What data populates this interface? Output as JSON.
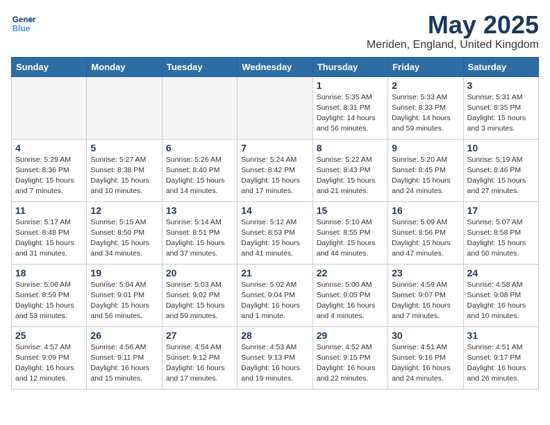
{
  "header": {
    "logo_line1": "General",
    "logo_line2": "Blue",
    "title": "May 2025",
    "subtitle": "Meriden, England, United Kingdom"
  },
  "weekdays": [
    "Sunday",
    "Monday",
    "Tuesday",
    "Wednesday",
    "Thursday",
    "Friday",
    "Saturday"
  ],
  "weeks": [
    [
      {
        "day": "",
        "info": "",
        "empty": true
      },
      {
        "day": "",
        "info": "",
        "empty": true
      },
      {
        "day": "",
        "info": "",
        "empty": true
      },
      {
        "day": "",
        "info": "",
        "empty": true
      },
      {
        "day": "1",
        "info": "Sunrise: 5:35 AM\nSunset: 8:31 PM\nDaylight: 14 hours\nand 56 minutes."
      },
      {
        "day": "2",
        "info": "Sunrise: 5:33 AM\nSunset: 8:33 PM\nDaylight: 14 hours\nand 59 minutes."
      },
      {
        "day": "3",
        "info": "Sunrise: 5:31 AM\nSunset: 8:35 PM\nDaylight: 15 hours\nand 3 minutes."
      }
    ],
    [
      {
        "day": "4",
        "info": "Sunrise: 5:29 AM\nSunset: 8:36 PM\nDaylight: 15 hours\nand 7 minutes."
      },
      {
        "day": "5",
        "info": "Sunrise: 5:27 AM\nSunset: 8:38 PM\nDaylight: 15 hours\nand 10 minutes."
      },
      {
        "day": "6",
        "info": "Sunrise: 5:26 AM\nSunset: 8:40 PM\nDaylight: 15 hours\nand 14 minutes."
      },
      {
        "day": "7",
        "info": "Sunrise: 5:24 AM\nSunset: 8:42 PM\nDaylight: 15 hours\nand 17 minutes."
      },
      {
        "day": "8",
        "info": "Sunrise: 5:22 AM\nSunset: 8:43 PM\nDaylight: 15 hours\nand 21 minutes."
      },
      {
        "day": "9",
        "info": "Sunrise: 5:20 AM\nSunset: 8:45 PM\nDaylight: 15 hours\nand 24 minutes."
      },
      {
        "day": "10",
        "info": "Sunrise: 5:19 AM\nSunset: 8:46 PM\nDaylight: 15 hours\nand 27 minutes."
      }
    ],
    [
      {
        "day": "11",
        "info": "Sunrise: 5:17 AM\nSunset: 8:48 PM\nDaylight: 15 hours\nand 31 minutes."
      },
      {
        "day": "12",
        "info": "Sunrise: 5:15 AM\nSunset: 8:50 PM\nDaylight: 15 hours\nand 34 minutes."
      },
      {
        "day": "13",
        "info": "Sunrise: 5:14 AM\nSunset: 8:51 PM\nDaylight: 15 hours\nand 37 minutes."
      },
      {
        "day": "14",
        "info": "Sunrise: 5:12 AM\nSunset: 8:53 PM\nDaylight: 15 hours\nand 41 minutes."
      },
      {
        "day": "15",
        "info": "Sunrise: 5:10 AM\nSunset: 8:55 PM\nDaylight: 15 hours\nand 44 minutes."
      },
      {
        "day": "16",
        "info": "Sunrise: 5:09 AM\nSunset: 8:56 PM\nDaylight: 15 hours\nand 47 minutes."
      },
      {
        "day": "17",
        "info": "Sunrise: 5:07 AM\nSunset: 8:58 PM\nDaylight: 15 hours\nand 50 minutes."
      }
    ],
    [
      {
        "day": "18",
        "info": "Sunrise: 5:06 AM\nSunset: 8:59 PM\nDaylight: 15 hours\nand 53 minutes."
      },
      {
        "day": "19",
        "info": "Sunrise: 5:04 AM\nSunset: 9:01 PM\nDaylight: 15 hours\nand 56 minutes."
      },
      {
        "day": "20",
        "info": "Sunrise: 5:03 AM\nSunset: 9:02 PM\nDaylight: 15 hours\nand 59 minutes."
      },
      {
        "day": "21",
        "info": "Sunrise: 5:02 AM\nSunset: 9:04 PM\nDaylight: 16 hours\nand 1 minute."
      },
      {
        "day": "22",
        "info": "Sunrise: 5:00 AM\nSunset: 9:05 PM\nDaylight: 16 hours\nand 4 minutes."
      },
      {
        "day": "23",
        "info": "Sunrise: 4:59 AM\nSunset: 9:07 PM\nDaylight: 16 hours\nand 7 minutes."
      },
      {
        "day": "24",
        "info": "Sunrise: 4:58 AM\nSunset: 9:08 PM\nDaylight: 16 hours\nand 10 minutes."
      }
    ],
    [
      {
        "day": "25",
        "info": "Sunrise: 4:57 AM\nSunset: 9:09 PM\nDaylight: 16 hours\nand 12 minutes."
      },
      {
        "day": "26",
        "info": "Sunrise: 4:56 AM\nSunset: 9:11 PM\nDaylight: 16 hours\nand 15 minutes."
      },
      {
        "day": "27",
        "info": "Sunrise: 4:54 AM\nSunset: 9:12 PM\nDaylight: 16 hours\nand 17 minutes."
      },
      {
        "day": "28",
        "info": "Sunrise: 4:53 AM\nSunset: 9:13 PM\nDaylight: 16 hours\nand 19 minutes."
      },
      {
        "day": "29",
        "info": "Sunrise: 4:52 AM\nSunset: 9:15 PM\nDaylight: 16 hours\nand 22 minutes."
      },
      {
        "day": "30",
        "info": "Sunrise: 4:51 AM\nSunset: 9:16 PM\nDaylight: 16 hours\nand 24 minutes."
      },
      {
        "day": "31",
        "info": "Sunrise: 4:51 AM\nSunset: 9:17 PM\nDaylight: 16 hours\nand 26 minutes."
      }
    ]
  ]
}
